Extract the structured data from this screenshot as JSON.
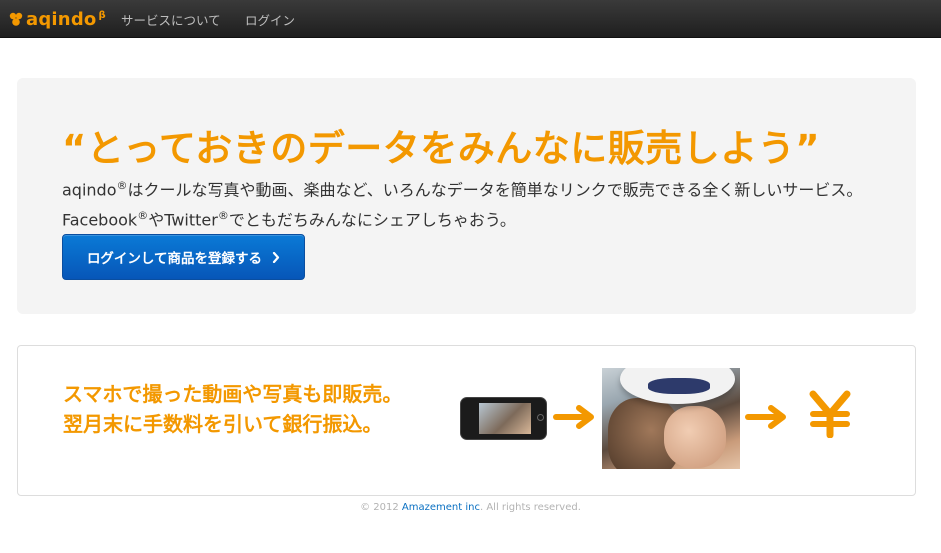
{
  "navbar": {
    "brand": "aqindo",
    "brand_sup": "β",
    "links": [
      "サービスについて",
      "ログイン"
    ]
  },
  "hero": {
    "title": "“とっておきのデータをみんなに販売しよう”",
    "desc_part1": "aqindo",
    "reg_mark": "®",
    "desc_part2": "はクールな写真や動画、楽曲など、いろんなデータを簡単なリンクで販売できる全く新しいサービス。 Facebook",
    "desc_part3": "やTwitter",
    "desc_part4": "でともだちみんなにシェアしちゃおう。",
    "cta_label": "ログインして商品を登録する"
  },
  "feature": {
    "line1": "スマホで撮った動画や写真も即販売。",
    "line2": "翌月末に手数料を引いて銀行振込。"
  },
  "footer": {
    "prefix": "© 2012 ",
    "company": "Amazement inc",
    "suffix": ". All rights reserved."
  },
  "colors": {
    "accent": "#f39800",
    "cta": "#0a66c8",
    "navbar": "#2b2b2b",
    "panel": "#f4f4f4"
  },
  "icons": [
    "aqindo-logo-icon",
    "chevron-right-icon",
    "smartphone-icon",
    "arrow-right-icon",
    "yen-icon"
  ]
}
